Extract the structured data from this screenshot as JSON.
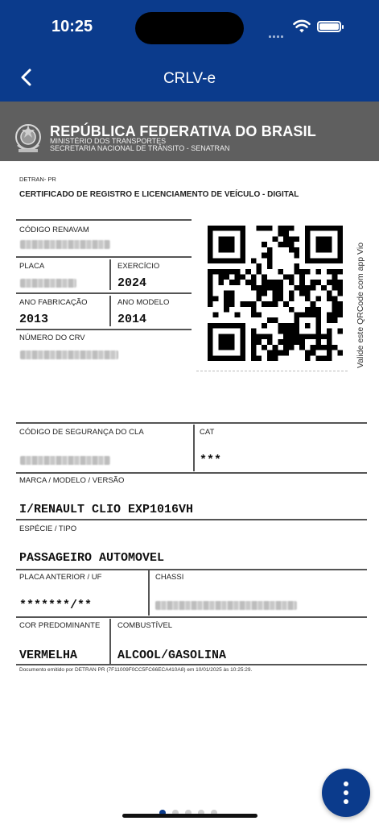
{
  "status_bar": {
    "time": "10:25"
  },
  "nav": {
    "title": "CRLV-e"
  },
  "header": {
    "title": "REPÚBLICA FEDERATIVA DO BRASIL",
    "line1": "MINISTÉRIO DOS TRANSPORTES",
    "line2": "SECRETARIA NACIONAL DE TRÂNSITO - SENATRAN"
  },
  "doc": {
    "issuer": "DETRAN- PR",
    "heading": "CERTIFICADO DE REGISTRO E LICENCIAMENTO DE VEÍCULO - DIGITAL"
  },
  "fields": {
    "renavam_label": "CÓDIGO RENAVAM",
    "placa_label": "PLACA",
    "exercicio_label": "EXERCÍCIO",
    "exercicio_value": "2024",
    "ano_fab_label": "ANO FABRICAÇÃO",
    "ano_fab_value": "2013",
    "ano_modelo_label": "ANO MODELO",
    "ano_modelo_value": "2014",
    "crv_label": "NÚMERO DO CRV",
    "seg_label": "CÓDIGO DE SEGURANÇA DO CLA",
    "cat_label": "CAT",
    "cat_value": "***",
    "marca_label": "MARCA / MODELO / VERSÃO",
    "marca_value": "I/RENAULT CLIO EXP1016VH",
    "especie_label": "ESPÉCIE / TIPO",
    "especie_value": "PASSAGEIRO AUTOMOVEL",
    "placa_ant_label": "PLACA ANTERIOR / UF",
    "placa_ant_value": "*******/**",
    "chassi_label": "CHASSI",
    "cor_label": "COR PREDOMINANTE",
    "cor_value": "VERMELHA",
    "comb_label": "COMBUSTÍVEL",
    "comb_value": "ALCOOL/GASOLINA"
  },
  "qr_caption": "Valide este QRCode com app Vio",
  "footnote": "Documento emitido por DETRAN PR (7F11009F0CC5FC66ECA410A8) em 10/01/2025 às 10:25:29.",
  "pager": {
    "count": 5,
    "active": 0
  },
  "colors": {
    "brand": "#0b3b8c",
    "header_gray": "#5f5f5f"
  }
}
